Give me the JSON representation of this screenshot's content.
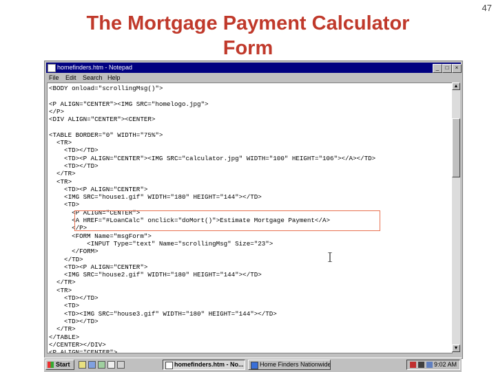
{
  "slide": {
    "title_line1": "The Mortgage Payment Calculator",
    "title_line2": "Form",
    "page_number": "47"
  },
  "window": {
    "title": "homefinders.htm - Notepad",
    "buttons": {
      "minimize": "_",
      "maximize": "□",
      "close": "×"
    },
    "menu": [
      "File",
      "Edit",
      "Search",
      "Help"
    ]
  },
  "editor": {
    "lines": [
      "<BODY onload=\"scrollingMsg()\">",
      "",
      "<P ALIGN=\"CENTER\"><IMG SRC=\"homelogo.jpg\">",
      "</P>",
      "<DIV ALIGN=\"CENTER\"><CENTER>",
      "",
      "<TABLE BORDER=\"0\" WIDTH=\"75%\">",
      "  <TR>",
      "    <TD></TD>",
      "    <TD><P ALIGN=\"CENTER\"><IMG SRC=\"calculator.jpg\" WIDTH=\"100\" HEIGHT=\"106\"></A></TD>",
      "    <TD></TD>",
      "  </TR>",
      "  <TR>",
      "    <TD><P ALIGN=\"CENTER\">",
      "    <IMG SRC=\"house1.gif\" WIDTH=\"180\" HEIGHT=\"144\"></TD>",
      "    <TD>",
      "      <P ALIGN=\"CENTER\">",
      "      <A HREF=\"#LoanCalc\" onclick=\"doMort()\">Estimate Mortgage Payment</A>",
      "      </P>",
      "      <FORM Name=\"msgForm\">",
      "          <INPUT Type=\"text\" Name=\"scrollingMsg\" Size=\"23\">",
      "      </FORM>",
      "    </TD>",
      "    <TD><P ALIGN=\"CENTER\">",
      "    <IMG SRC=\"house2.gif\" WIDTH=\"180\" HEIGHT=\"144\"></TD>",
      "  </TR>",
      "  <TR>",
      "    <TD></TD>",
      "    <TD>",
      "    <TD><IMG SRC=\"house3.gif\" WIDTH=\"180\" HEIGHT=\"144\"></TD>",
      "    <TD></TD>",
      "  </TR>",
      "</TABLE>",
      "</CENTER></DIV>",
      "<P ALIGN=\"CENTER\">"
    ]
  },
  "taskbar": {
    "start_label": "Start",
    "tasks": [
      {
        "label": "homefinders.htm - No...",
        "active": true
      },
      {
        "label": "Home Finders Nationwide ...",
        "active": false
      }
    ],
    "clock": "9:02 AM"
  },
  "colors": {
    "title": "#c0392b",
    "titlebar": "#000080",
    "highlight_box": "#e8704f",
    "chrome": "#c0c0c0"
  }
}
